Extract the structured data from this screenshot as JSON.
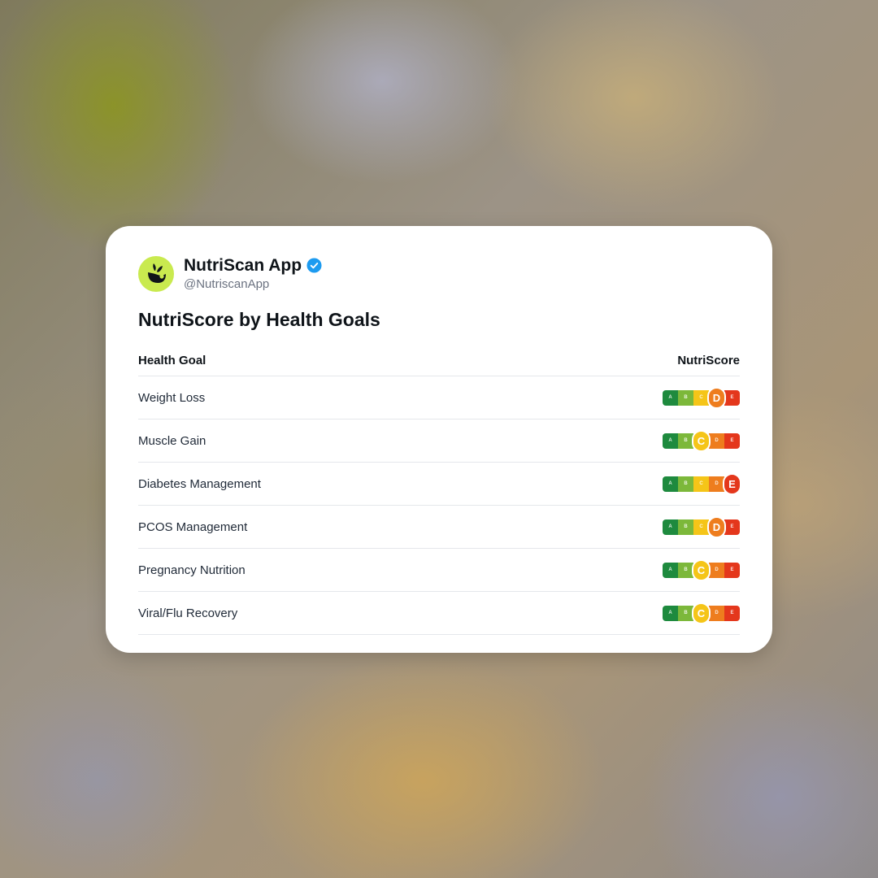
{
  "account": {
    "name": "NutriScan App",
    "handle": "@NutriscanApp",
    "verified_icon": "verified-badge-icon",
    "avatar_icon": "nutriscan-logo-icon",
    "avatar_color": "#c9ea4f",
    "verified_color": "#1d9bf0"
  },
  "post": {
    "title": "NutriScore by Health Goals"
  },
  "table": {
    "headers": {
      "goal": "Health Goal",
      "score": "NutriScore"
    },
    "rows": [
      {
        "goal": "Weight Loss",
        "score": "D"
      },
      {
        "goal": "Muscle Gain",
        "score": "C"
      },
      {
        "goal": "Diabetes Management",
        "score": "E"
      },
      {
        "goal": "PCOS Management",
        "score": "D"
      },
      {
        "goal": "Pregnancy Nutrition",
        "score": "C"
      },
      {
        "goal": "Viral/Flu Recovery",
        "score": "C"
      }
    ]
  },
  "nutriscore_scale": {
    "grades": [
      "A",
      "B",
      "C",
      "D",
      "E"
    ],
    "colors": {
      "A": "#1e8a3e",
      "B": "#7cb83a",
      "C": "#f5c518",
      "D": "#ee7d1e",
      "E": "#e4371c"
    }
  }
}
